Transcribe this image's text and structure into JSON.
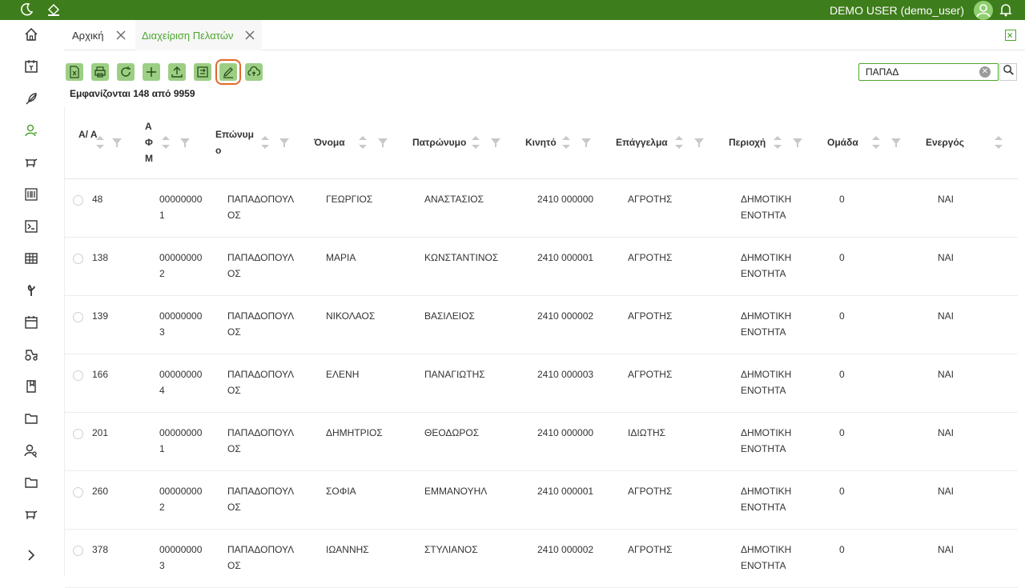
{
  "topbar": {
    "user": "DEMO USER (demo_user)",
    "icons": [
      "moon-icon",
      "paint-bucket-icon",
      "user-avatar-icon",
      "bell-icon"
    ],
    "brand_color": "#3e7d1b"
  },
  "tabs": [
    {
      "label": "Αρχική",
      "active": false
    },
    {
      "label": "Διαχείριση Πελατών",
      "active": true
    }
  ],
  "toolbar": {
    "buttons": [
      "excel-icon",
      "print-icon",
      "refresh-icon",
      "add-icon",
      "upload-icon",
      "export-icon",
      "edit-icon",
      "cloud-upload-icon"
    ],
    "highlighted": "edit-icon"
  },
  "count_text": "Εμφανίζονται 148 από 9959",
  "search": {
    "value": "ΠΑΠΑΔ"
  },
  "columns": {
    "aa": "Α/ Α",
    "afm": "Α Φ Μ",
    "surname": "Επώνυμ ο",
    "name": "Όνομα",
    "father": "Πατρώνυμο",
    "mobile": "Κινητό",
    "job": "Επάγγελμα",
    "area": "Περιοχή",
    "group": "Ομάδα",
    "active": "Ενεργός"
  },
  "rows": [
    {
      "aa": "48",
      "afm": "000000001",
      "surname": "ΠΑΠΑΔΟΠΟΥΛΟΣ",
      "name": "ΓΕΩΡΓΙΟΣ",
      "father": "ΑΝΑΣΤΑΣΙΟΣ",
      "mobile": "2410 000000",
      "job": "ΑΓΡΟΤΗΣ",
      "area": "ΔΗΜΟΤΙΚΗ ΕΝΟΤΗΤΑ",
      "group": "0",
      "active": "ΝΑΙ"
    },
    {
      "aa": "138",
      "afm": "000000002",
      "surname": "ΠΑΠΑΔΟΠΟΥΛΟΣ",
      "name": "ΜΑΡΙΑ",
      "father": "ΚΩΝΣΤΑΝΤΙΝΟΣ",
      "mobile": "2410 000001",
      "job": "ΑΓΡΟΤΗΣ",
      "area": "ΔΗΜΟΤΙΚΗ ΕΝΟΤΗΤΑ",
      "group": "0",
      "active": "ΝΑΙ"
    },
    {
      "aa": "139",
      "afm": "000000003",
      "surname": "ΠΑΠΑΔΟΠΟΥΛΟΣ",
      "name": "ΝΙΚΟΛΑΟΣ",
      "father": "ΒΑΣΙΛΕΙΟΣ",
      "mobile": "2410 000002",
      "job": "ΑΓΡΟΤΗΣ",
      "area": "ΔΗΜΟΤΙΚΗ ΕΝΟΤΗΤΑ",
      "group": "0",
      "active": "ΝΑΙ"
    },
    {
      "aa": "166",
      "afm": "000000004",
      "surname": "ΠΑΠΑΔΟΠΟΥΛΟΣ",
      "name": "ΕΛΕΝΗ",
      "father": "ΠΑΝΑΓΙΩΤΗΣ",
      "mobile": "2410 000003",
      "job": "ΑΓΡΟΤΗΣ",
      "area": "ΔΗΜΟΤΙΚΗ ΕΝΟΤΗΤΑ",
      "group": "0",
      "active": "ΝΑΙ"
    },
    {
      "aa": "201",
      "afm": "000000001",
      "surname": "ΠΑΠΑΔΟΠΟΥΛΟΣ",
      "name": "ΔΗΜΗΤΡΙΟΣ",
      "father": "ΘΕΟΔΩΡΟΣ",
      "mobile": "2410 000000",
      "job": "ΙΔΙΩΤΗΣ",
      "area": "ΔΗΜΟΤΙΚΗ ΕΝΟΤΗΤΑ",
      "group": "0",
      "active": "ΝΑΙ"
    },
    {
      "aa": "260",
      "afm": "000000002",
      "surname": "ΠΑΠΑΔΟΠΟΥΛΟΣ",
      "name": "ΣΟΦΙΑ",
      "father": "ΕΜΜΑΝΟΥΗΛ",
      "mobile": "2410 000001",
      "job": "ΑΓΡΟΤΗΣ",
      "area": "ΔΗΜΟΤΙΚΗ ΕΝΟΤΗΤΑ",
      "group": "0",
      "active": "ΝΑΙ"
    },
    {
      "aa": "378",
      "afm": "000000003",
      "surname": "ΠΑΠΑΔΟΠΟΥΛΟΣ",
      "name": "ΙΩΑΝΝΗΣ",
      "father": "ΣΤΥΛΙΑΝΟΣ",
      "mobile": "2410 000002",
      "job": "ΑΓΡΟΤΗΣ",
      "area": "ΔΗΜΟΤΙΚΗ ΕΝΟΤΗΤΑ",
      "group": "0",
      "active": "ΝΑΙ"
    }
  ],
  "sidebar": {
    "icons": [
      "home-icon",
      "calendar-money-icon",
      "feather-icon",
      "customers-icon",
      "cow-icon",
      "barcode-icon",
      "terminal-icon",
      "table-icon",
      "seed-icon",
      "calendar-icon",
      "tractor-icon",
      "book-icon",
      "folder-icon",
      "user-search-icon",
      "folder-icon-2",
      "cow-icon-2",
      "expand-icon"
    ]
  }
}
